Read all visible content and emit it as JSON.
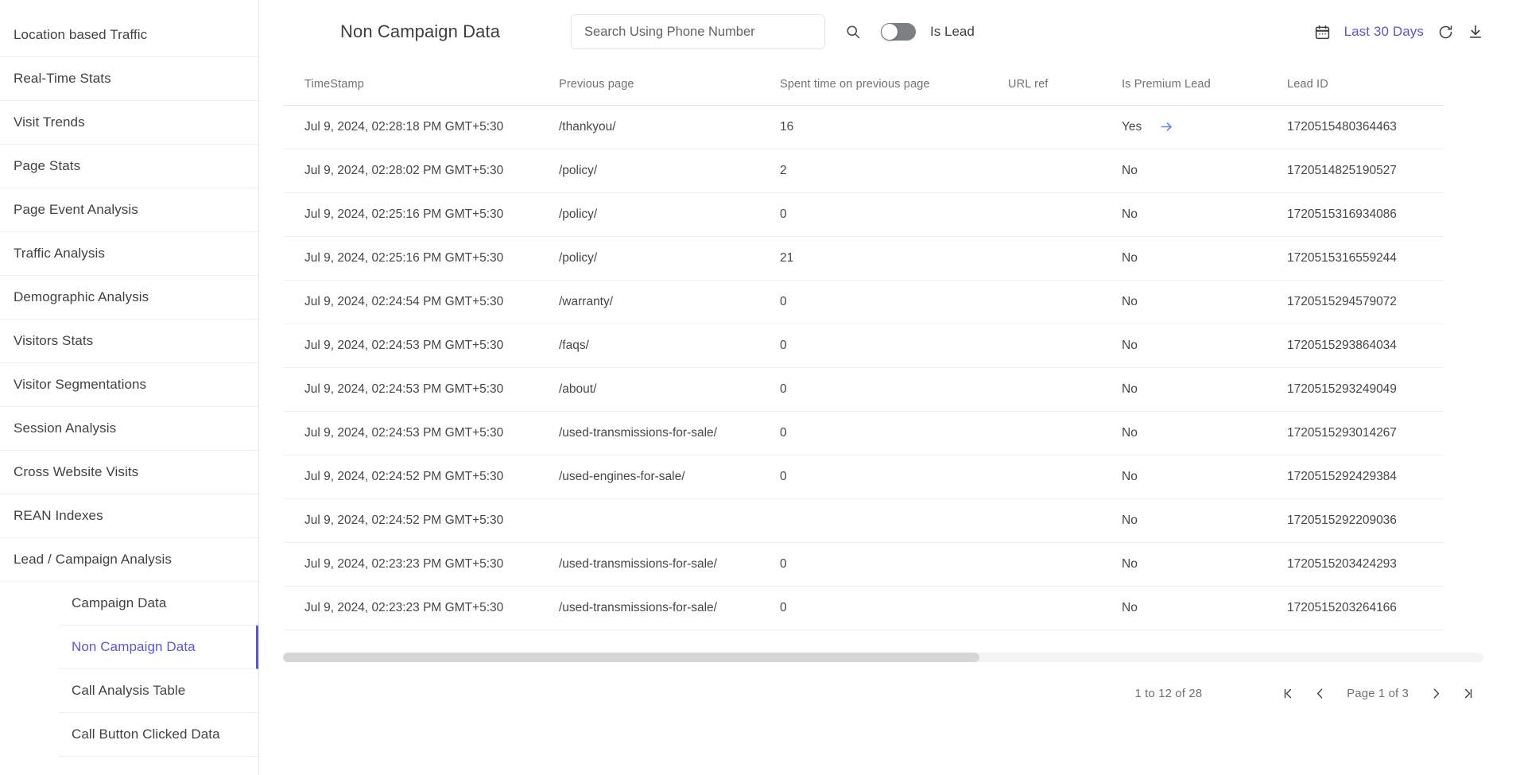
{
  "sidebar": {
    "items": [
      {
        "label": "Location based Traffic",
        "level": 0,
        "active": false
      },
      {
        "label": "Real-Time Stats",
        "level": 0,
        "active": false
      },
      {
        "label": "Visit Trends",
        "level": 0,
        "active": false
      },
      {
        "label": "Page Stats",
        "level": 0,
        "active": false
      },
      {
        "label": "Page Event Analysis",
        "level": 0,
        "active": false
      },
      {
        "label": "Traffic Analysis",
        "level": 0,
        "active": false
      },
      {
        "label": "Demographic Analysis",
        "level": 0,
        "active": false
      },
      {
        "label": "Visitors Stats",
        "level": 0,
        "active": false
      },
      {
        "label": "Visitor Segmentations",
        "level": 0,
        "active": false
      },
      {
        "label": "Session Analysis",
        "level": 0,
        "active": false
      },
      {
        "label": "Cross Website Visits",
        "level": 0,
        "active": false
      },
      {
        "label": "REAN Indexes",
        "level": 0,
        "active": false
      },
      {
        "label": "Lead / Campaign Analysis",
        "level": 0,
        "active": false
      },
      {
        "label": "Campaign Data",
        "level": 1,
        "active": false
      },
      {
        "label": "Non Campaign Data",
        "level": 1,
        "active": true
      },
      {
        "label": "Call Analysis Table",
        "level": 1,
        "active": false
      },
      {
        "label": "Call Button Clicked Data",
        "level": 1,
        "active": false
      }
    ]
  },
  "header": {
    "title": "Non Campaign Data",
    "search": {
      "value": "",
      "placeholder": "Search Using Phone Number"
    },
    "search_icon": "search-icon",
    "toggle": {
      "label": "Is Lead",
      "on": false
    },
    "calendar_icon": "calendar-icon",
    "date_range": "Last 30 Days",
    "refresh_icon": "refresh-icon",
    "download_icon": "download-icon",
    "accent_color": "#5c55d8"
  },
  "table": {
    "columns": [
      "TimeStamp",
      "Previous page",
      "Spent time on previous page",
      "URL ref",
      "Is Premium Lead",
      "Lead ID"
    ],
    "rows": [
      {
        "timestamp": "Jul 9, 2024, 02:28:18 PM GMT+5:30",
        "previous_page": "/thankyou/",
        "spent_time": "16",
        "url_ref": "",
        "is_premium_lead": "Yes",
        "has_arrow": true,
        "lead_id": "1720515480364463"
      },
      {
        "timestamp": "Jul 9, 2024, 02:28:02 PM GMT+5:30",
        "previous_page": "/policy/",
        "spent_time": "2",
        "url_ref": "",
        "is_premium_lead": "No",
        "has_arrow": false,
        "lead_id": "1720514825190527"
      },
      {
        "timestamp": "Jul 9, 2024, 02:25:16 PM GMT+5:30",
        "previous_page": "/policy/",
        "spent_time": "0",
        "url_ref": "",
        "is_premium_lead": "No",
        "has_arrow": false,
        "lead_id": "1720515316934086"
      },
      {
        "timestamp": "Jul 9, 2024, 02:25:16 PM GMT+5:30",
        "previous_page": "/policy/",
        "spent_time": "21",
        "url_ref": "",
        "is_premium_lead": "No",
        "has_arrow": false,
        "lead_id": "1720515316559244"
      },
      {
        "timestamp": "Jul 9, 2024, 02:24:54 PM GMT+5:30",
        "previous_page": "/warranty/",
        "spent_time": "0",
        "url_ref": "",
        "is_premium_lead": "No",
        "has_arrow": false,
        "lead_id": "1720515294579072"
      },
      {
        "timestamp": "Jul 9, 2024, 02:24:53 PM GMT+5:30",
        "previous_page": "/faqs/",
        "spent_time": "0",
        "url_ref": "",
        "is_premium_lead": "No",
        "has_arrow": false,
        "lead_id": "1720515293864034"
      },
      {
        "timestamp": "Jul 9, 2024, 02:24:53 PM GMT+5:30",
        "previous_page": "/about/",
        "spent_time": "0",
        "url_ref": "",
        "is_premium_lead": "No",
        "has_arrow": false,
        "lead_id": "1720515293249049"
      },
      {
        "timestamp": "Jul 9, 2024, 02:24:53 PM GMT+5:30",
        "previous_page": "/used-transmissions-for-sale/",
        "spent_time": "0",
        "url_ref": "",
        "is_premium_lead": "No",
        "has_arrow": false,
        "lead_id": "1720515293014267"
      },
      {
        "timestamp": "Jul 9, 2024, 02:24:52 PM GMT+5:30",
        "previous_page": "/used-engines-for-sale/",
        "spent_time": "0",
        "url_ref": "",
        "is_premium_lead": "No",
        "has_arrow": false,
        "lead_id": "1720515292429384"
      },
      {
        "timestamp": "Jul 9, 2024, 02:24:52 PM GMT+5:30",
        "previous_page": "",
        "spent_time": "",
        "url_ref": "",
        "is_premium_lead": "No",
        "has_arrow": false,
        "lead_id": "1720515292209036"
      },
      {
        "timestamp": "Jul 9, 2024, 02:23:23 PM GMT+5:30",
        "previous_page": "/used-transmissions-for-sale/",
        "spent_time": "0",
        "url_ref": "",
        "is_premium_lead": "No",
        "has_arrow": false,
        "lead_id": "1720515203424293"
      },
      {
        "timestamp": "Jul 9, 2024, 02:23:23 PM GMT+5:30",
        "previous_page": "/used-transmissions-for-sale/",
        "spent_time": "0",
        "url_ref": "",
        "is_premium_lead": "No",
        "has_arrow": false,
        "lead_id": "1720515203264166"
      }
    ]
  },
  "pagination": {
    "range_text": "1 to 12 of 28",
    "page_text": "Page 1 of 3",
    "first_icon": "first-page-icon",
    "prev_icon": "previous-page-icon",
    "next_icon": "next-page-icon",
    "last_icon": "last-page-icon"
  }
}
